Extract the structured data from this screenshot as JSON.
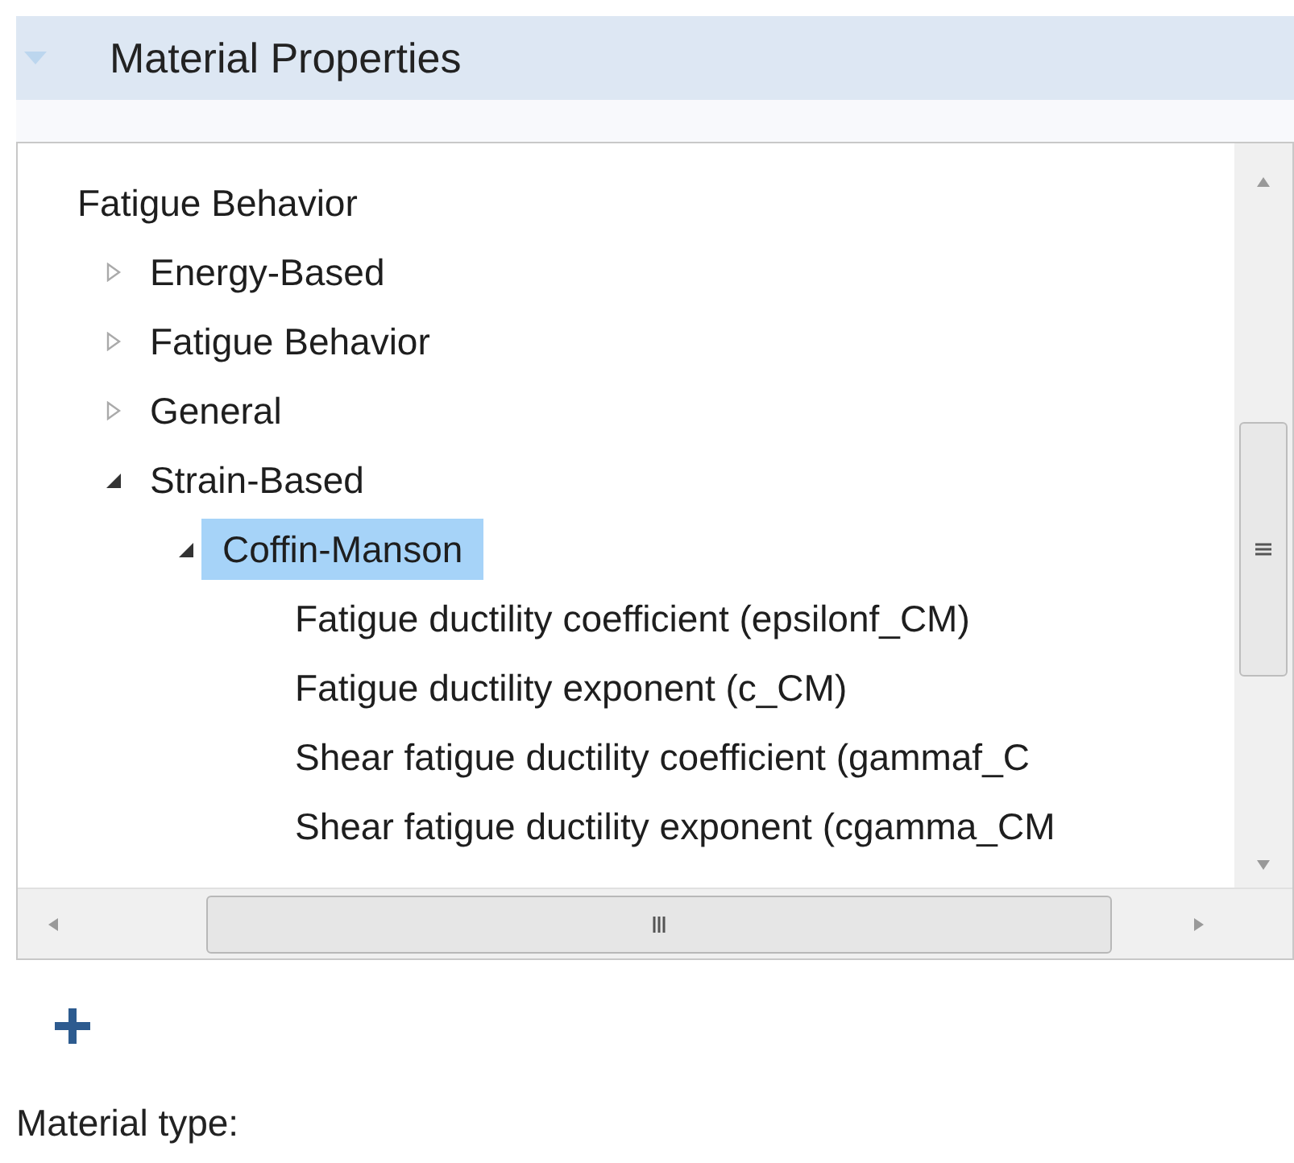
{
  "section": {
    "title": "Material Properties",
    "expanded": true
  },
  "tree": [
    {
      "label": "Fatigue Behavior",
      "selected": false,
      "children": [
        {
          "label": "Energy-Based",
          "expanded": false,
          "selected": false
        },
        {
          "label": "Fatigue Behavior",
          "expanded": false,
          "selected": false
        },
        {
          "label": "General",
          "expanded": false,
          "selected": false
        },
        {
          "label": "Strain-Based",
          "expanded": true,
          "selected": false,
          "children": [
            {
              "label": "Coffin-Manson",
              "expanded": true,
              "selected": true,
              "children": [
                {
                  "label": "Fatigue ductility coefficient (epsilonf_CM)",
                  "selected": false
                },
                {
                  "label": "Fatigue ductility exponent (c_CM)",
                  "selected": false
                },
                {
                  "label": "Shear fatigue ductility coefficient (gammaf_C",
                  "selected": false
                },
                {
                  "label": "Shear fatigue ductility exponent (cgamma_CM",
                  "selected": false
                }
              ]
            }
          ]
        }
      ]
    }
  ],
  "material_type_label": "Material type:"
}
